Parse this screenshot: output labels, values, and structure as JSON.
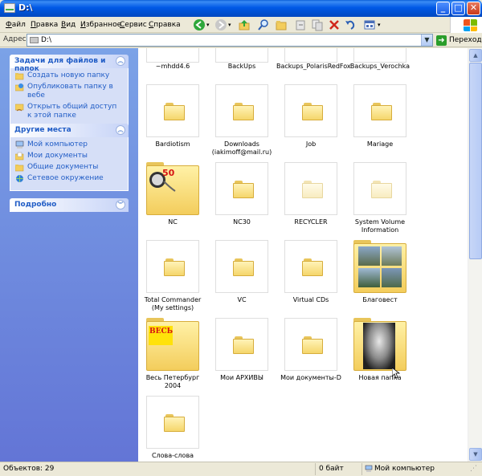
{
  "window": {
    "title": "D:\\"
  },
  "titlebar_buttons": {
    "minimize": "_",
    "maximize": "□",
    "close": "✕"
  },
  "menu": [
    {
      "pre": "",
      "u": "Ф",
      "post": "айл"
    },
    {
      "pre": "",
      "u": "П",
      "post": "равка"
    },
    {
      "pre": "",
      "u": "В",
      "post": "ид"
    },
    {
      "pre": "",
      "u": "И",
      "post": "збранное"
    },
    {
      "pre": "",
      "u": "С",
      "post": "ервис"
    },
    {
      "pre": "",
      "u": "С",
      "post": "правка"
    }
  ],
  "address": {
    "label": "Адрес:",
    "value": "D:\\",
    "go_label": "Переход"
  },
  "tasks_panel": {
    "title": "Задачи для файлов и папок",
    "items": [
      {
        "label": "Создать новую папку",
        "icon": "new-folder-icon"
      },
      {
        "label": "Опубликовать папку в вебе",
        "icon": "globe-icon"
      },
      {
        "label": "Открыть общий доступ к этой папке",
        "icon": "share-folder-icon"
      }
    ]
  },
  "places_panel": {
    "title": "Другие места",
    "items": [
      {
        "label": "Мой компьютер",
        "icon": "computer-icon"
      },
      {
        "label": "Мои документы",
        "icon": "documents-folder-icon"
      },
      {
        "label": "Общие документы",
        "icon": "folder-icon"
      },
      {
        "label": "Сетевое окружение",
        "icon": "network-icon"
      }
    ]
  },
  "details_panel": {
    "title": "Подробно"
  },
  "folders": [
    "~mhdd4.6",
    "BackUps",
    "Backups_PolarisRedFox",
    "Backups_Verochka",
    "Bardiotism",
    "Downloads (iakimoff@mail.ru)",
    "Job",
    "Mariage",
    "NC",
    "NC30",
    "RECYCLER",
    "System Volume Information",
    "Total Commander (My settings)",
    "VC",
    "Virtual CDs",
    "Благовест",
    "Весь Петербург 2004",
    "Мои АРХИВЫ",
    "Мои документы-D",
    "Новая папка",
    "Слова-слова"
  ],
  "nc_badge": "50",
  "ves_badge": "ВЕСЬ",
  "status": {
    "objects": "Объектов: 29",
    "size": "0 байт",
    "location": "Мой компьютер"
  },
  "colors": {
    "title_blue": "#0052d4",
    "task_pane": "#7ba2e7",
    "link_blue": "#215dc6",
    "folder_yellow": "#f5d66b"
  }
}
